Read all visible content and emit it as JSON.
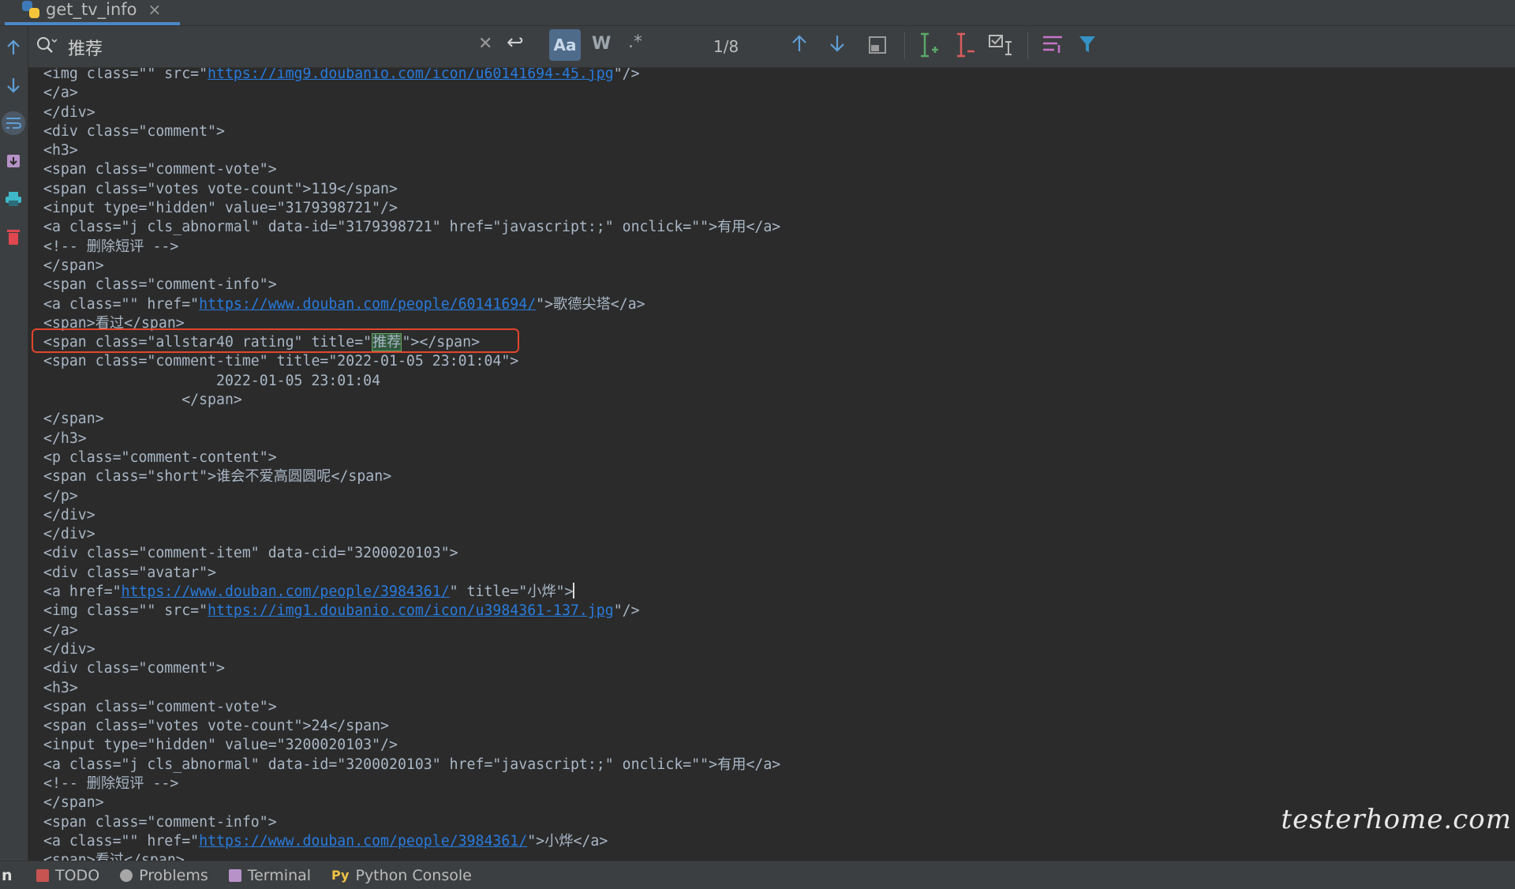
{
  "tab": {
    "title": "get_tv_info"
  },
  "search": {
    "query": "推荐",
    "match_case_label": "Aa",
    "words_label": "W",
    "regex_label": ".*",
    "match_count": "1/8"
  },
  "code_lines": [
    [
      "<img class=\"\" src=\"",
      {
        "link": "https://img9.doubanio.com/icon/u60141694-45.jpg"
      },
      "\"/>"
    ],
    [
      "</a>"
    ],
    [
      "</div>"
    ],
    [
      "<div class=\"comment\">"
    ],
    [
      "<h3>"
    ],
    [
      "<span class=\"comment-vote\">"
    ],
    [
      "<span class=\"votes vote-count\">119</span>"
    ],
    [
      "<input type=\"hidden\" value=\"3179398721\"/>"
    ],
    [
      "<a class=\"j cls_abnormal\" data-id=\"3179398721\" href=\"javascript:;\" onclick=\"\">有用</a>"
    ],
    [
      "<!-- 删除短评 -->"
    ],
    [
      "</span>"
    ],
    [
      "<span class=\"comment-info\">"
    ],
    [
      "<a class=\"\" href=\"",
      {
        "link": "https://www.douban.com/people/60141694/"
      },
      "\">歌德尖塔</a>"
    ],
    [
      "<span>看过</span>"
    ],
    [
      "<span class=\"allstar40 rating\" title=\"",
      {
        "hl": "推荐"
      },
      "\"></span>"
    ],
    [
      "<span class=\"comment-time\" title=\"2022-01-05 23:01:04\">"
    ],
    [
      "                    2022-01-05 23:01:04"
    ],
    [
      "                </span>"
    ],
    [
      "</span>"
    ],
    [
      "</h3>"
    ],
    [
      "<p class=\"comment-content\">"
    ],
    [
      "<span class=\"short\">谁会不爱高圆圆呢</span>"
    ],
    [
      "</p>"
    ],
    [
      "</div>"
    ],
    [
      "</div>"
    ],
    [
      "<div class=\"comment-item\" data-cid=\"3200020103\">"
    ],
    [
      "<div class=\"avatar\">"
    ],
    [
      "<a href=\"",
      {
        "link": "https://www.douban.com/people/3984361/"
      },
      "\" title=\"小烨\">",
      {
        "caret": true
      }
    ],
    [
      "<img class=\"\" src=\"",
      {
        "link": "https://img1.doubanio.com/icon/u3984361-137.jpg"
      },
      "\"/>"
    ],
    [
      "</a>"
    ],
    [
      "</div>"
    ],
    [
      "<div class=\"comment\">"
    ],
    [
      "<h3>"
    ],
    [
      "<span class=\"comment-vote\">"
    ],
    [
      "<span class=\"votes vote-count\">24</span>"
    ],
    [
      "<input type=\"hidden\" value=\"3200020103\"/>"
    ],
    [
      "<a class=\"j cls_abnormal\" data-id=\"3200020103\" href=\"javascript:;\" onclick=\"\">有用</a>"
    ],
    [
      "<!-- 删除短评 -->"
    ],
    [
      "</span>"
    ],
    [
      "<span class=\"comment-info\">"
    ],
    [
      "<a class=\"\" href=\"",
      {
        "link": "https://www.douban.com/people/3984361/"
      },
      "\">小烨</a>"
    ],
    [
      "<span>看过</span>"
    ]
  ],
  "bottom_bar": {
    "clipped_label": "n",
    "todo": "TODO",
    "problems": "Problems",
    "terminal": "Terminal",
    "python_console": "Python Console"
  },
  "watermark": "testerhome.com",
  "colors": {
    "editor_bg": "#2b2b2b",
    "panel_bg": "#3c3f41",
    "link": "#287bde",
    "annotation_box": "#e2462c",
    "match_highlight": "#32593d"
  }
}
